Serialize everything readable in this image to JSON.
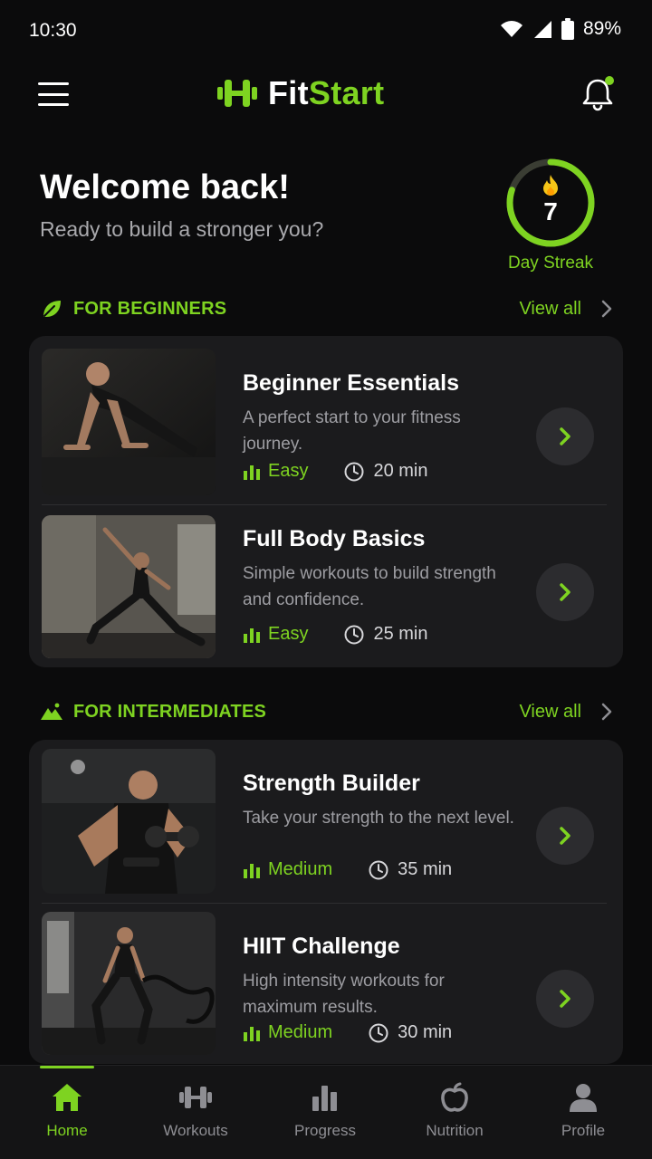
{
  "status_bar": {
    "time": "10:30",
    "battery": "89%"
  },
  "header": {
    "logo_part1": "Fit",
    "logo_part2": "Start",
    "icons": [
      "menu-icon",
      "dumbbell-icon",
      "bell-icon"
    ]
  },
  "welcome": {
    "title": "Welcome back!",
    "subtitle": "Ready to build a stronger you?"
  },
  "streak": {
    "days": "7",
    "label": "Day Streak",
    "progress": 0.8
  },
  "sections": [
    {
      "title": "FOR BEGINNERS",
      "icon": "leaf-icon",
      "view_all": "View all",
      "workouts": [
        {
          "title": "Beginner Essentials",
          "desc": "A perfect start to your fitness journey.",
          "level": "Easy",
          "duration": "20 min",
          "image": "pushup-photo"
        },
        {
          "title": "Full Body Basics",
          "desc": "Simple workouts to build strength and confidence.",
          "level": "Easy",
          "duration": "25 min",
          "image": "yoga-stretch-photo"
        }
      ]
    },
    {
      "title": "FOR INTERMEDIATES",
      "icon": "mountain-icon",
      "view_all": "View all",
      "workouts": [
        {
          "title": "Strength Builder",
          "desc": "Take your strength to the next level.",
          "level": "Medium",
          "duration": "35 min",
          "image": "dumbbell-curl-photo"
        },
        {
          "title": "HIIT Challenge",
          "desc": "High intensity workouts for maximum results.",
          "level": "Medium",
          "duration": "30 min",
          "image": "battle-rope-photo"
        }
      ]
    }
  ],
  "nav": [
    {
      "label": "Home",
      "icon": "home-icon",
      "active": true
    },
    {
      "label": "Workouts",
      "icon": "dumbbell-icon"
    },
    {
      "label": "Progress",
      "icon": "bar-chart-icon"
    },
    {
      "label": "Nutrition",
      "icon": "apple-icon"
    },
    {
      "label": "Profile",
      "icon": "person-icon"
    }
  ],
  "colors": {
    "accent": "#7ed321",
    "background": "#0b0b0c",
    "card": "#1b1b1d"
  }
}
